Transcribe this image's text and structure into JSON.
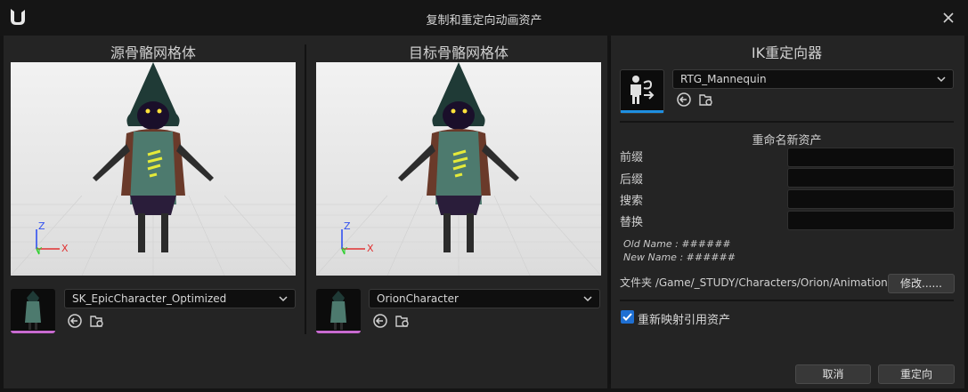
{
  "window": {
    "title": "复制和重定向动画资产"
  },
  "source": {
    "title": "源骨骼网格体",
    "mesh_name": "SK_EpicCharacter_Optimized",
    "axis": {
      "z": "Z",
      "x": "X",
      "y": "Y"
    }
  },
  "target": {
    "title": "目标骨骼网格体",
    "mesh_name": "OrionCharacter",
    "axis": {
      "z": "Z",
      "x": "X",
      "y": "Y"
    }
  },
  "retargeter": {
    "title": "IK重定向器",
    "asset_name": "RTG_Mannequin"
  },
  "rename": {
    "title": "重命名新资产",
    "prefix_label": "前缀",
    "suffix_label": "后缀",
    "search_label": "搜索",
    "replace_label": "替换",
    "prefix_value": "",
    "suffix_value": "",
    "search_value": "",
    "replace_value": "",
    "old_name": "Old Name : ######",
    "new_name": "New Name : ######"
  },
  "folder": {
    "label": "文件夹",
    "path": "/Game/_STUDY/Characters/Orion/Animation",
    "modify_label": "修改......"
  },
  "remap": {
    "label": "重新映射引用资产",
    "checked": true
  },
  "footer": {
    "cancel_label": "取消",
    "retarget_label": "重定向"
  },
  "colors": {
    "accent_blue": "#1e6fd2",
    "thumb_underline": "#c86ad0",
    "axis_x": "#e03030",
    "axis_y": "#30d030",
    "axis_z": "#3050f0"
  }
}
